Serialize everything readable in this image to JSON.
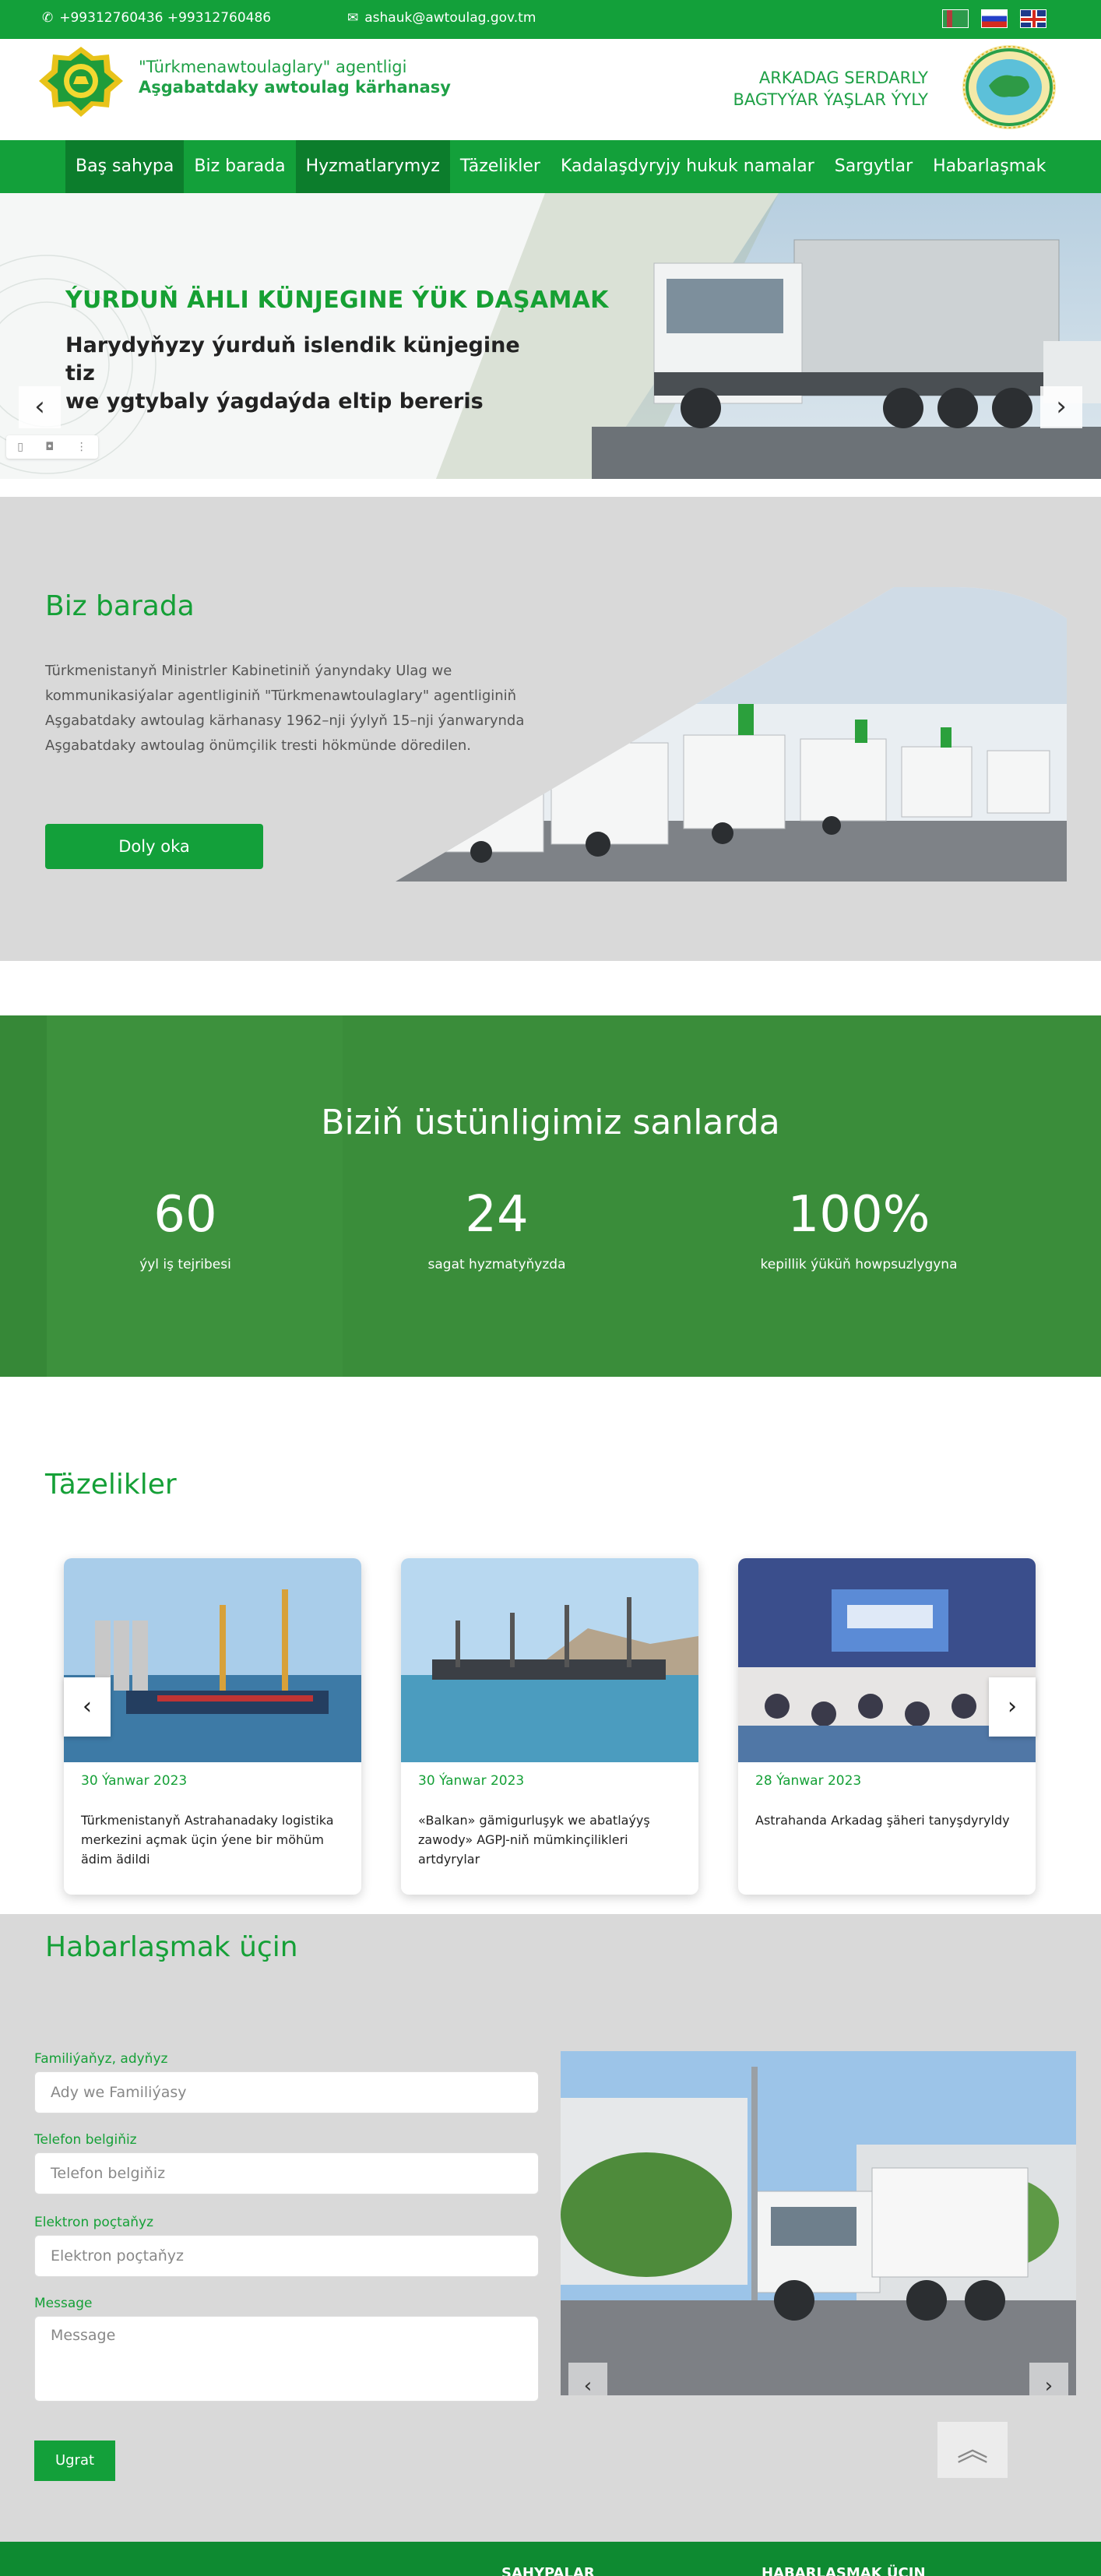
{
  "topbar": {
    "phones": "+99312760436 +99312760486",
    "email": "ashauk@awtoulag.gov.tm",
    "languages": [
      "tm-flag-icon",
      "ru-flag-icon",
      "en-flag-icon"
    ]
  },
  "header": {
    "org_line1": "\"Türkmenawtoulaglary\" agentligi",
    "org_line2": "Aşgabatdaky awtoulag kärhanasy",
    "motto_line1": "ARKADAG SERDARLY",
    "motto_line2": "BAGTYÝAR ÝAŞLAR ÝYLY"
  },
  "nav": {
    "items": [
      {
        "label": "Baş sahypa"
      },
      {
        "label": "Biz barada"
      },
      {
        "label": "Hyzmatlarymyz"
      },
      {
        "label": "Täzelikler"
      },
      {
        "label": "Kadalaşdyryjy hukuk namalar"
      },
      {
        "label": "Sargytlar"
      },
      {
        "label": "Habarlaşmak"
      }
    ]
  },
  "hero": {
    "title": "ÝURDUŇ ÄHLI KÜNJEGINE ÝÜK DAŞAMAK",
    "subtitle_line1": "Harydyňyzy ýurduň islendik künjegine tiz",
    "subtitle_line2": "we ygtybaly ýagdaýda eltip bereris",
    "prev": "‹",
    "next": "›"
  },
  "about": {
    "title": "Biz barada",
    "text": "Türkmenistanyň Ministrler Kabinetiniň ýanyndaky Ulag we kommunikasiýalar agentliginiň \"Türkmenawtoulaglary\" agentliginiň Aşgabatdaky awtoulag kärhanasy 1962–nji ýylyň 15–nji ýanwarynda Aşgabatdaky awtoulag önümçilik tresti hökmünde döredilen.",
    "button": "Doly oka"
  },
  "stats": {
    "title": "Biziň üstünligimiz sanlarda",
    "items": [
      {
        "num": "60",
        "label": "ýyl iş tejribesi"
      },
      {
        "num": "24",
        "label": "sagat hyzmatyňyzda"
      },
      {
        "num": "100%",
        "label": "kepillik ýüküň howpsuzlygyna"
      }
    ]
  },
  "news": {
    "title": "Täzelikler",
    "cards": [
      {
        "date": "30 Ýanwar 2023",
        "text": "Türkmenistanyň Astrahanadaky logistika merkezini açmak üçin ýene bir möhüm ädim ädildi"
      },
      {
        "date": "30 Ýanwar 2023",
        "text": "«Balkan» gämigurluşyk we abatlaýyş zawody» AGPJ-niň mümkinçilikleri artdyrylar"
      },
      {
        "date": "28 Ýanwar 2023",
        "text": "Astrahanda Arkadag şäheri tanyşdyryldy"
      }
    ],
    "prev": "‹",
    "next": "›"
  },
  "contact": {
    "title": "Habarlaşmak üçin",
    "fields": [
      {
        "label": "Familiýaňyz, adyňyz",
        "placeholder": "Ady we Familiýasy"
      },
      {
        "label": "Telefon belgiňiz",
        "placeholder": "Telefon belgiňiz"
      },
      {
        "label": "Elektron poçtaňyz",
        "placeholder": "Elektron poçtaňyz"
      },
      {
        "label": "Message",
        "placeholder": "Message"
      }
    ],
    "send": "Ugrat",
    "prev": "‹",
    "next": "›",
    "scroll_top": "︽"
  },
  "footer": {
    "col1": "SAHYPALAR",
    "col2": "HABARLAŞMAK ÜÇIN"
  },
  "colors": {
    "brand_green": "#13a03a",
    "dark_green": "#0c7d2c",
    "stats_bg": "#3a8d3a",
    "section_gray": "#d9d9d9"
  }
}
